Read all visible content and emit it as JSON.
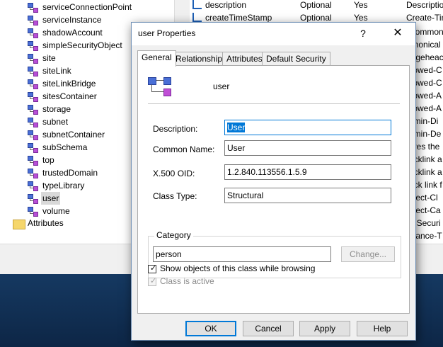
{
  "tree": {
    "items": [
      {
        "label": "serviceConnectionPoint"
      },
      {
        "label": "serviceInstance"
      },
      {
        "label": "shadowAccount"
      },
      {
        "label": "simpleSecurityObject"
      },
      {
        "label": "site"
      },
      {
        "label": "siteLink"
      },
      {
        "label": "siteLinkBridge"
      },
      {
        "label": "sitesContainer"
      },
      {
        "label": "storage"
      },
      {
        "label": "subnet"
      },
      {
        "label": "subnetContainer"
      },
      {
        "label": "subSchema"
      },
      {
        "label": "top"
      },
      {
        "label": "trustedDomain"
      },
      {
        "label": "typeLibrary"
      },
      {
        "label": "user"
      },
      {
        "label": "volume"
      }
    ],
    "selected": "user",
    "attributes_folder": "Attributes"
  },
  "list": {
    "rows": [
      {
        "name": "description",
        "type": "Optional",
        "system": "Yes",
        "desc": "Descriptio"
      },
      {
        "name": "createTimeStamp",
        "type": "Optional",
        "system": "Yes",
        "desc": "Create-Tim"
      }
    ],
    "partial_texts": [
      "Common",
      "anonical",
      "idgeheac",
      "llowed-C",
      "llowed-C",
      "llowed-A",
      "llowed-A",
      "dmin-Di",
      "dmin-De",
      "ores the",
      "acklink a",
      "acklink a",
      "ack link f",
      "bject-Cl",
      "bject-Ca",
      "T-Securi",
      "stance-T"
    ]
  },
  "dialog": {
    "title": "user Properties",
    "help": "?",
    "close": "✕",
    "tabs": [
      "General",
      "Relationship",
      "Attributes",
      "Default Security"
    ],
    "active_tab": "General",
    "class_name": "user",
    "fields": {
      "description_label": "Description:",
      "description_value": "User",
      "common_name_label": "Common Name:",
      "common_name_value": "User",
      "oid_label": "X.500 OID:",
      "oid_value": "1.2.840.113556.1.5.9",
      "class_type_label": "Class Type:",
      "class_type_value": "Structural"
    },
    "category": {
      "legend": "Category",
      "value": "person",
      "change_button": "Change..."
    },
    "show_objects": {
      "label": "Show objects of this class while browsing",
      "checked": true
    },
    "class_active": {
      "label": "Class is active",
      "checked": true,
      "disabled": true
    },
    "buttons": {
      "ok": "OK",
      "cancel": "Cancel",
      "apply": "Apply",
      "help": "Help"
    }
  },
  "colors": {
    "accent": "#0078d7",
    "selection": "#d9d9d9"
  }
}
